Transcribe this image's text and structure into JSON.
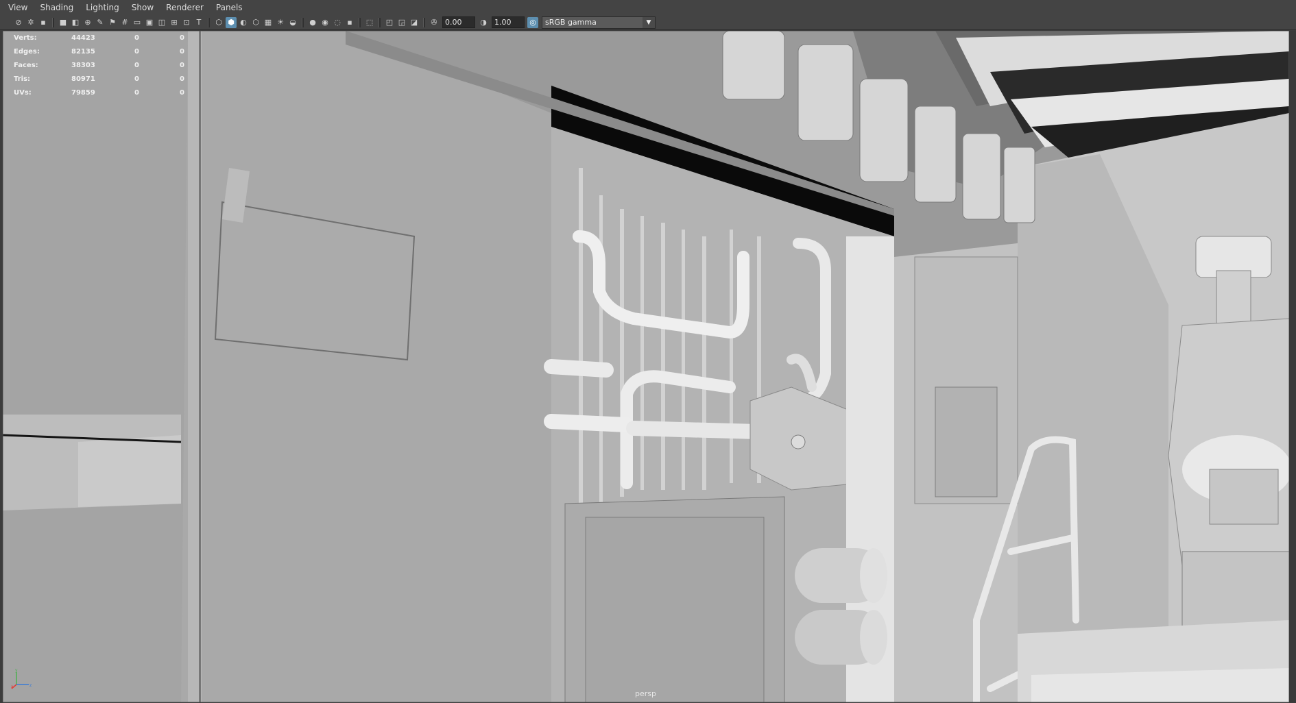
{
  "menu": [
    "View",
    "Shading",
    "Lighting",
    "Show",
    "Renderer",
    "Panels"
  ],
  "toolbar": {
    "exposure": "0.00",
    "gamma": "1.00",
    "color_space": "sRGB gamma"
  },
  "hud": {
    "rows": [
      {
        "label": "Verts:",
        "value": "44423",
        "sel": "0",
        "comp": "0"
      },
      {
        "label": "Edges:",
        "value": "82135",
        "sel": "0",
        "comp": "0"
      },
      {
        "label": "Faces:",
        "value": "38303",
        "sel": "0",
        "comp": "0"
      },
      {
        "label": "Tris:",
        "value": "80971",
        "sel": "0",
        "comp": "0"
      },
      {
        "label": "UVs:",
        "value": "79859",
        "sel": "0",
        "comp": "0"
      }
    ]
  },
  "camera_label": "persp",
  "axis": {
    "x": "x",
    "y": "y",
    "z": "z"
  }
}
